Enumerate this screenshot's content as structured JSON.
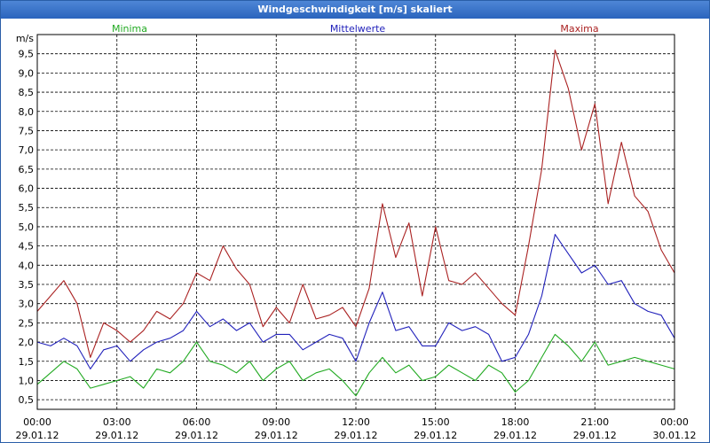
{
  "window": {
    "title": "Windgeschwindigkeit [m/s] skaliert"
  },
  "chart_data": {
    "type": "line",
    "title": "Windgeschwindigkeit [m/s] skaliert",
    "ylabel": "m/s",
    "xlabel": "",
    "ylim": [
      0.25,
      10.0
    ],
    "xlim": [
      0,
      24
    ],
    "grid": true,
    "legend_position": "top",
    "y_ticks": [
      "0,5",
      "1,0",
      "1,5",
      "2,0",
      "2,5",
      "3,0",
      "3,5",
      "4,0",
      "4,5",
      "5,0",
      "5,5",
      "6,0",
      "6,5",
      "7,0",
      "7,5",
      "8,0",
      "8,5",
      "9,0",
      "9,5"
    ],
    "y_tick_values": [
      0.5,
      1.0,
      1.5,
      2.0,
      2.5,
      3.0,
      3.5,
      4.0,
      4.5,
      5.0,
      5.5,
      6.0,
      6.5,
      7.0,
      7.5,
      8.0,
      8.5,
      9.0,
      9.5
    ],
    "x_ticks": [
      {
        "value": 0,
        "time": "00:00",
        "date": "29.01.12"
      },
      {
        "value": 3,
        "time": "03:00",
        "date": "29.01.12"
      },
      {
        "value": 6,
        "time": "06:00",
        "date": "29.01.12"
      },
      {
        "value": 9,
        "time": "09:00",
        "date": "29.01.12"
      },
      {
        "value": 12,
        "time": "12:00",
        "date": "29.01.12"
      },
      {
        "value": 15,
        "time": "15:00",
        "date": "29.01.12"
      },
      {
        "value": 18,
        "time": "18:00",
        "date": "29.01.12"
      },
      {
        "value": 21,
        "time": "21:00",
        "date": "29.01.12"
      },
      {
        "value": 24,
        "time": "00:00",
        "date": "30.01.12"
      }
    ],
    "series": [
      {
        "name": "Minima",
        "color": "#22aa22",
        "points": [
          [
            0,
            0.9
          ],
          [
            0.5,
            1.2
          ],
          [
            1,
            1.5
          ],
          [
            1.5,
            1.3
          ],
          [
            2,
            0.8
          ],
          [
            2.5,
            0.9
          ],
          [
            3,
            1.0
          ],
          [
            3.5,
            1.1
          ],
          [
            4,
            0.8
          ],
          [
            4.5,
            1.3
          ],
          [
            5,
            1.2
          ],
          [
            5.5,
            1.5
          ],
          [
            6,
            2.0
          ],
          [
            6.5,
            1.5
          ],
          [
            7,
            1.4
          ],
          [
            7.5,
            1.2
          ],
          [
            8,
            1.5
          ],
          [
            8.5,
            1.0
          ],
          [
            9,
            1.3
          ],
          [
            9.5,
            1.5
          ],
          [
            10,
            1.0
          ],
          [
            10.5,
            1.2
          ],
          [
            11,
            1.3
          ],
          [
            11.5,
            1.0
          ],
          [
            12,
            0.6
          ],
          [
            12.5,
            1.2
          ],
          [
            13,
            1.6
          ],
          [
            13.5,
            1.2
          ],
          [
            14,
            1.4
          ],
          [
            14.5,
            1.0
          ],
          [
            15,
            1.1
          ],
          [
            15.5,
            1.4
          ],
          [
            16,
            1.2
          ],
          [
            16.5,
            1.0
          ],
          [
            17,
            1.4
          ],
          [
            17.5,
            1.2
          ],
          [
            18,
            0.7
          ],
          [
            18.5,
            1.0
          ],
          [
            19,
            1.6
          ],
          [
            19.5,
            2.2
          ],
          [
            20,
            1.9
          ],
          [
            20.5,
            1.5
          ],
          [
            21,
            2.0
          ],
          [
            21.5,
            1.4
          ],
          [
            22,
            1.5
          ],
          [
            22.5,
            1.6
          ],
          [
            23,
            1.5
          ],
          [
            23.5,
            1.4
          ],
          [
            24,
            1.3
          ]
        ]
      },
      {
        "name": "Mittelwerte",
        "color": "#2222bb",
        "points": [
          [
            0,
            2.0
          ],
          [
            0.5,
            1.9
          ],
          [
            1,
            2.1
          ],
          [
            1.5,
            1.9
          ],
          [
            2,
            1.3
          ],
          [
            2.5,
            1.8
          ],
          [
            3,
            1.9
          ],
          [
            3.5,
            1.5
          ],
          [
            4,
            1.8
          ],
          [
            4.5,
            2.0
          ],
          [
            5,
            2.1
          ],
          [
            5.5,
            2.3
          ],
          [
            6,
            2.8
          ],
          [
            6.5,
            2.4
          ],
          [
            7,
            2.6
          ],
          [
            7.5,
            2.3
          ],
          [
            8,
            2.5
          ],
          [
            8.5,
            2.0
          ],
          [
            9,
            2.2
          ],
          [
            9.5,
            2.2
          ],
          [
            10,
            1.8
          ],
          [
            10.5,
            2.0
          ],
          [
            11,
            2.2
          ],
          [
            11.5,
            2.1
          ],
          [
            12,
            1.5
          ],
          [
            12.5,
            2.5
          ],
          [
            13,
            3.3
          ],
          [
            13.5,
            2.3
          ],
          [
            14,
            2.4
          ],
          [
            14.5,
            1.9
          ],
          [
            15,
            1.9
          ],
          [
            15.5,
            2.5
          ],
          [
            16,
            2.3
          ],
          [
            16.5,
            2.4
          ],
          [
            17,
            2.2
          ],
          [
            17.5,
            1.5
          ],
          [
            18,
            1.6
          ],
          [
            18.5,
            2.2
          ],
          [
            19,
            3.2
          ],
          [
            19.5,
            4.8
          ],
          [
            20,
            4.3
          ],
          [
            20.5,
            3.8
          ],
          [
            21,
            4.0
          ],
          [
            21.5,
            3.5
          ],
          [
            22,
            3.6
          ],
          [
            22.5,
            3.0
          ],
          [
            23,
            2.8
          ],
          [
            23.5,
            2.7
          ],
          [
            24,
            2.1
          ]
        ]
      },
      {
        "name": "Maxima",
        "color": "#aa2222",
        "points": [
          [
            0,
            2.8
          ],
          [
            0.5,
            3.2
          ],
          [
            1,
            3.6
          ],
          [
            1.5,
            3.0
          ],
          [
            2,
            1.6
          ],
          [
            2.5,
            2.5
          ],
          [
            3,
            2.3
          ],
          [
            3.5,
            2.0
          ],
          [
            4,
            2.3
          ],
          [
            4.5,
            2.8
          ],
          [
            5,
            2.6
          ],
          [
            5.5,
            3.0
          ],
          [
            6,
            3.8
          ],
          [
            6.5,
            3.6
          ],
          [
            7,
            4.5
          ],
          [
            7.5,
            3.9
          ],
          [
            8,
            3.5
          ],
          [
            8.5,
            2.4
          ],
          [
            9,
            2.9
          ],
          [
            9.5,
            2.5
          ],
          [
            10,
            3.5
          ],
          [
            10.5,
            2.6
          ],
          [
            11,
            2.7
          ],
          [
            11.5,
            2.9
          ],
          [
            12,
            2.4
          ],
          [
            12.5,
            3.4
          ],
          [
            13,
            5.6
          ],
          [
            13.5,
            4.2
          ],
          [
            14,
            5.1
          ],
          [
            14.5,
            3.2
          ],
          [
            15,
            5.0
          ],
          [
            15.5,
            3.6
          ],
          [
            16,
            3.5
          ],
          [
            16.5,
            3.8
          ],
          [
            17,
            3.4
          ],
          [
            17.5,
            3.0
          ],
          [
            18,
            2.7
          ],
          [
            18.5,
            4.5
          ],
          [
            19,
            6.5
          ],
          [
            19.5,
            9.6
          ],
          [
            20,
            8.6
          ],
          [
            20.5,
            7.0
          ],
          [
            21,
            8.2
          ],
          [
            21.5,
            5.6
          ],
          [
            22,
            7.2
          ],
          [
            22.5,
            5.8
          ],
          [
            23,
            5.4
          ],
          [
            23.5,
            4.4
          ],
          [
            24,
            3.8
          ]
        ]
      }
    ]
  }
}
